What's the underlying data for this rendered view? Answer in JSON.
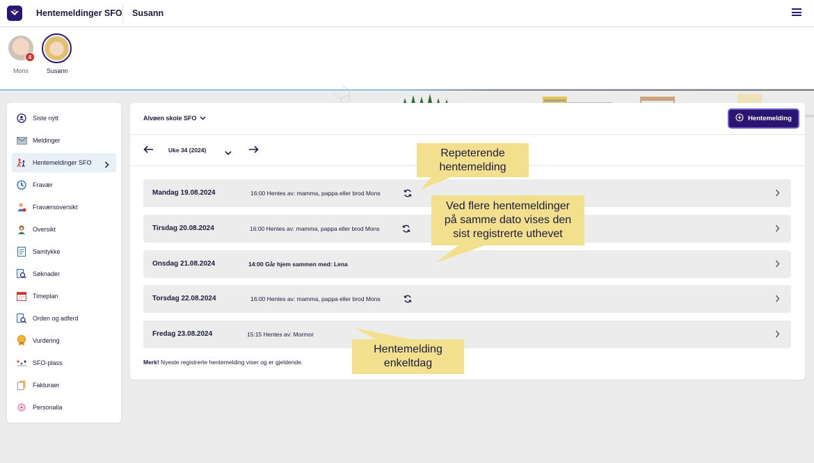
{
  "topbar": {
    "app_title": "Hentemeldinger SFO",
    "child_name": "Susann",
    "menu_icon": "hamburger-icon"
  },
  "children": [
    {
      "name": "Mons",
      "badge": "4"
    },
    {
      "name": "Susann"
    }
  ],
  "sidebar": {
    "items": [
      {
        "label": "Siste nytt",
        "icon": "news-icon"
      },
      {
        "label": "Meldinger",
        "icon": "envelope-icon"
      },
      {
        "label": "Hentemeldinger SFO",
        "icon": "pickup-icon",
        "active": true
      },
      {
        "label": "Fravær",
        "icon": "clock-icon"
      },
      {
        "label": "Fraværsoversikt",
        "icon": "absence-overview-icon"
      },
      {
        "label": "Oversikt",
        "icon": "person-icon"
      },
      {
        "label": "Samtykke",
        "icon": "consent-icon"
      },
      {
        "label": "Søknader",
        "icon": "search-document-icon"
      },
      {
        "label": "Timeplan",
        "icon": "calendar-icon"
      },
      {
        "label": "Orden og adferd",
        "icon": "conduct-icon"
      },
      {
        "label": "Vurdering",
        "icon": "medal-icon"
      },
      {
        "label": "SFO-plass",
        "icon": "sfo-place-icon"
      },
      {
        "label": "Fakturaer",
        "icon": "invoice-icon"
      },
      {
        "label": "Personalia",
        "icon": "personalia-icon"
      }
    ]
  },
  "main": {
    "school": "Alvøen skole SFO",
    "new_button": "Hentemelding",
    "week_label": "Uke 34 (2024)",
    "rows": [
      {
        "date": "Mandag 19.08.2024",
        "info": "16:00 Hentes av: mamma, pappa eller brod Mons",
        "repeat": true,
        "bold": false
      },
      {
        "date": "Tirsdag 20.08.2024",
        "info": "16:00 Hentes av: mamma, pappa eller brod Mons",
        "repeat": true,
        "bold": false
      },
      {
        "date": "Onsdag 21.08.2024",
        "info": "14:00 Går hjem sammen med: Lena",
        "repeat": false,
        "bold": true
      },
      {
        "date": "Torsdag 22.08.2024",
        "info": "16:00 Hentes av: mamma, pappa eller brod Mons",
        "repeat": true,
        "bold": false
      },
      {
        "date": "Fredag 23.08.2024",
        "info": "15:15 Hentes av: Mormor",
        "repeat": false,
        "bold": false
      }
    ],
    "note_bold": "Merk!",
    "note_text": " Nyeste registrerte hentemelding viser og er gjeldende."
  },
  "callouts": {
    "repeat": [
      "Repeterende",
      "hentemelding"
    ],
    "multiple": [
      "Ved flere hentemeldinger",
      "på samme dato vises den",
      "sist registrerte uthevet"
    ],
    "single": [
      "Hentemelding",
      "enkeltdag"
    ]
  },
  "colors": {
    "brand": "#2a1670",
    "callout": "#f3e08e",
    "row_bg": "#ececec",
    "badge": "#d6322b"
  }
}
